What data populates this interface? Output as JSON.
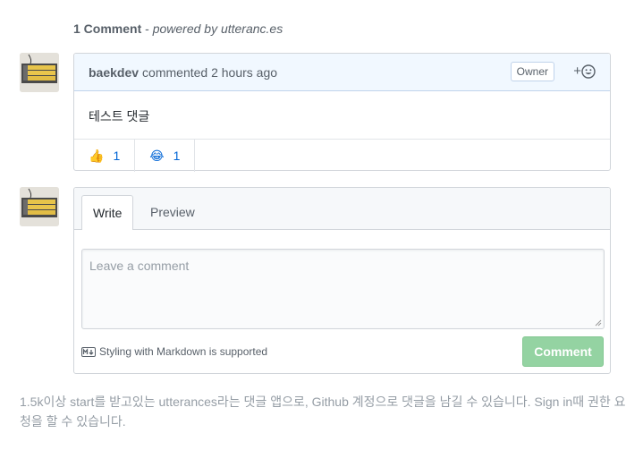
{
  "header": {
    "count": "1 Comment",
    "separator": " - ",
    "powered": "powered by utteranc.es"
  },
  "comment": {
    "author": "baekdev",
    "meta": "commented 2 hours ago",
    "badge": "Owner",
    "add_reaction": "+",
    "body": "테스트 댓글",
    "reactions": [
      {
        "icon": "thumbs-up-icon",
        "emoji": "👍",
        "count": "1"
      },
      {
        "icon": "laugh-icon",
        "emoji": "😂",
        "count": "1"
      }
    ]
  },
  "editor": {
    "tabs": [
      "Write",
      "Preview"
    ],
    "placeholder": "Leave a comment",
    "markdown_note": "Styling with Markdown is supported",
    "submit": "Comment"
  },
  "footer": {
    "text": "1.5k이상 start를 받고있는 utterances라는 댓글 앱으로, Github 계정으로 댓글을 남길 수 있습니다. Sign in때 권한 요청을 할 수 있습니다."
  },
  "colors": {
    "accent": "#0366d6",
    "header_bg": "#f1f8ff",
    "submit_bg": "#94d3a2"
  }
}
